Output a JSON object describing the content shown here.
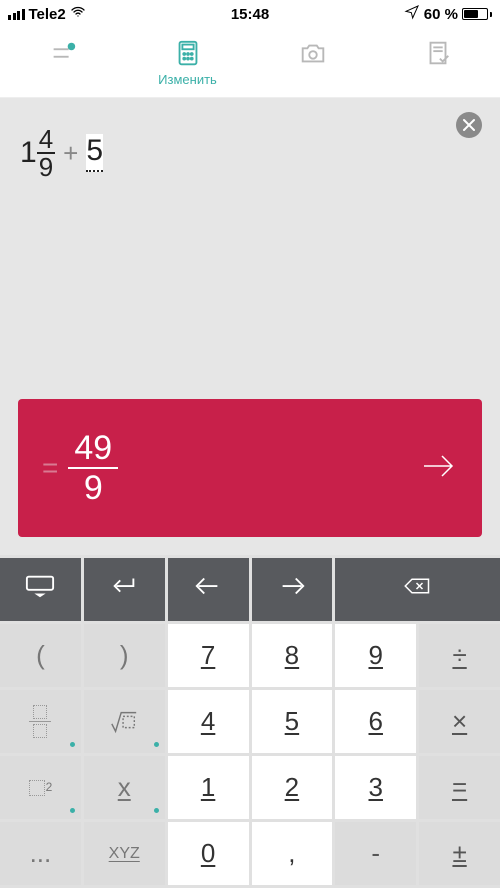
{
  "status": {
    "carrier": "Tele2",
    "time": "15:48",
    "battery_pct": "60 %"
  },
  "tabs": {
    "edit_label": "Изменить"
  },
  "expression": {
    "whole": "1",
    "numerator": "4",
    "denominator": "9",
    "operator": "+",
    "rhs": "5"
  },
  "result": {
    "equals": "=",
    "numerator": "49",
    "denominator": "9"
  },
  "keys": {
    "r2": {
      "c1": "(",
      "c2": ")",
      "c3": "7",
      "c4": "8",
      "c5": "9",
      "c6": "÷"
    },
    "r3": {
      "c3": "4",
      "c4": "5",
      "c5": "6",
      "c6": "×"
    },
    "r4": {
      "c2": "x",
      "c3": "1",
      "c4": "2",
      "c5": "3",
      "c6": "="
    },
    "r5": {
      "c1": "...",
      "c2": "XYZ",
      "c3": "0",
      "c4": ",",
      "c6": "±"
    },
    "sq_exp": "2",
    "minus": "-"
  }
}
